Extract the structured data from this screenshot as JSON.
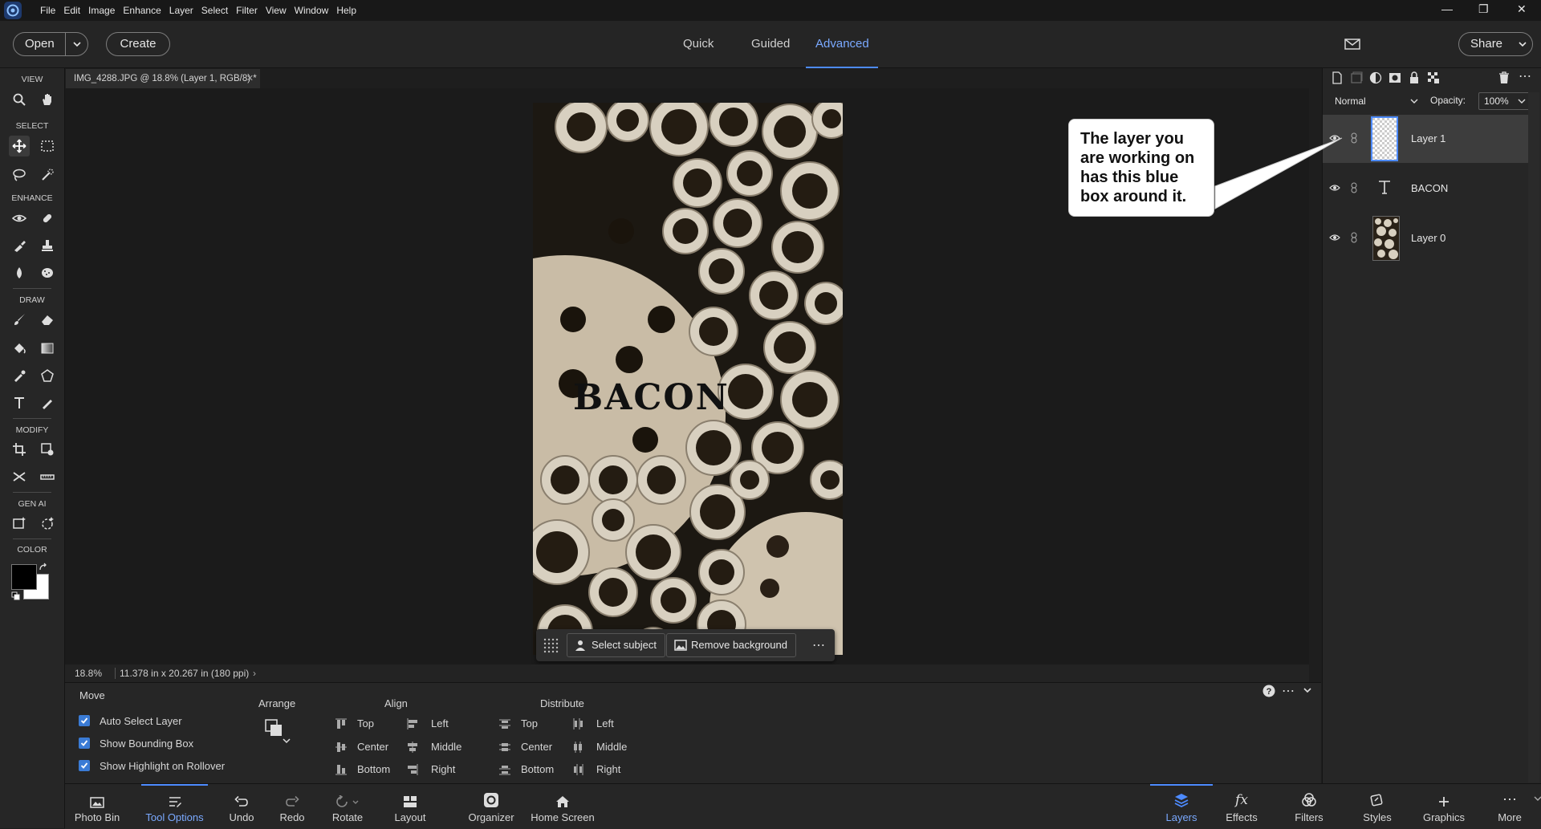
{
  "menubar": {
    "items": [
      "File",
      "Edit",
      "Image",
      "Enhance",
      "Layer",
      "Select",
      "Filter",
      "View",
      "Window",
      "Help"
    ]
  },
  "topbar": {
    "open_label": "Open",
    "create_label": "Create",
    "tabs": [
      "Quick",
      "Guided",
      "Advanced"
    ],
    "active_tab": "Advanced",
    "share_label": "Share"
  },
  "toolbox": {
    "sections": [
      "VIEW",
      "SELECT",
      "ENHANCE",
      "DRAW",
      "MODIFY",
      "GEN AI",
      "COLOR"
    ],
    "foreground_color": "#000000",
    "background_color": "#ffffff"
  },
  "document": {
    "tab_title": "IMG_4288.JPG @ 18.8% (Layer 1, RGB/8) *",
    "overlay_text": "BACON"
  },
  "context_bar": {
    "select_subject": "Select subject",
    "remove_background": "Remove background"
  },
  "statusbar": {
    "zoom": "18.8%",
    "doc_size": "11.378 in x 20.267 in (180 ppi)"
  },
  "tool_options": {
    "tool_name": "Move",
    "checkboxes": [
      "Auto Select Layer",
      "Show Bounding Box",
      "Show Highlight on Rollover"
    ],
    "arrange_label": "Arrange",
    "align_label": "Align",
    "distribute_label": "Distribute",
    "align_col1": [
      "Top",
      "Center",
      "Bottom"
    ],
    "align_col2": [
      "Left",
      "Middle",
      "Right"
    ],
    "distribute_col1": [
      "Top",
      "Center",
      "Bottom"
    ],
    "distribute_col2": [
      "Left",
      "Middle",
      "Right"
    ]
  },
  "bottombar": {
    "left_items": [
      "Photo Bin",
      "Tool Options",
      "Undo",
      "Redo",
      "Rotate",
      "Layout",
      "Organizer",
      "Home Screen"
    ],
    "right_items": [
      "Layers",
      "Effects",
      "Filters",
      "Styles",
      "Graphics",
      "More"
    ],
    "active_left": "Tool Options",
    "active_right": "Layers"
  },
  "layers_panel": {
    "blend_mode": "Normal",
    "opacity_label": "Opacity:",
    "opacity_value": "100%",
    "layers": [
      "Layer 1",
      "BACON",
      "Layer 0"
    ],
    "selected_layer": "Layer 1"
  },
  "callout": {
    "text": "The layer you are working on has this blue box around it."
  },
  "colors": {
    "accent": "#4d8bff",
    "checkbox": "#3a7bd5"
  }
}
